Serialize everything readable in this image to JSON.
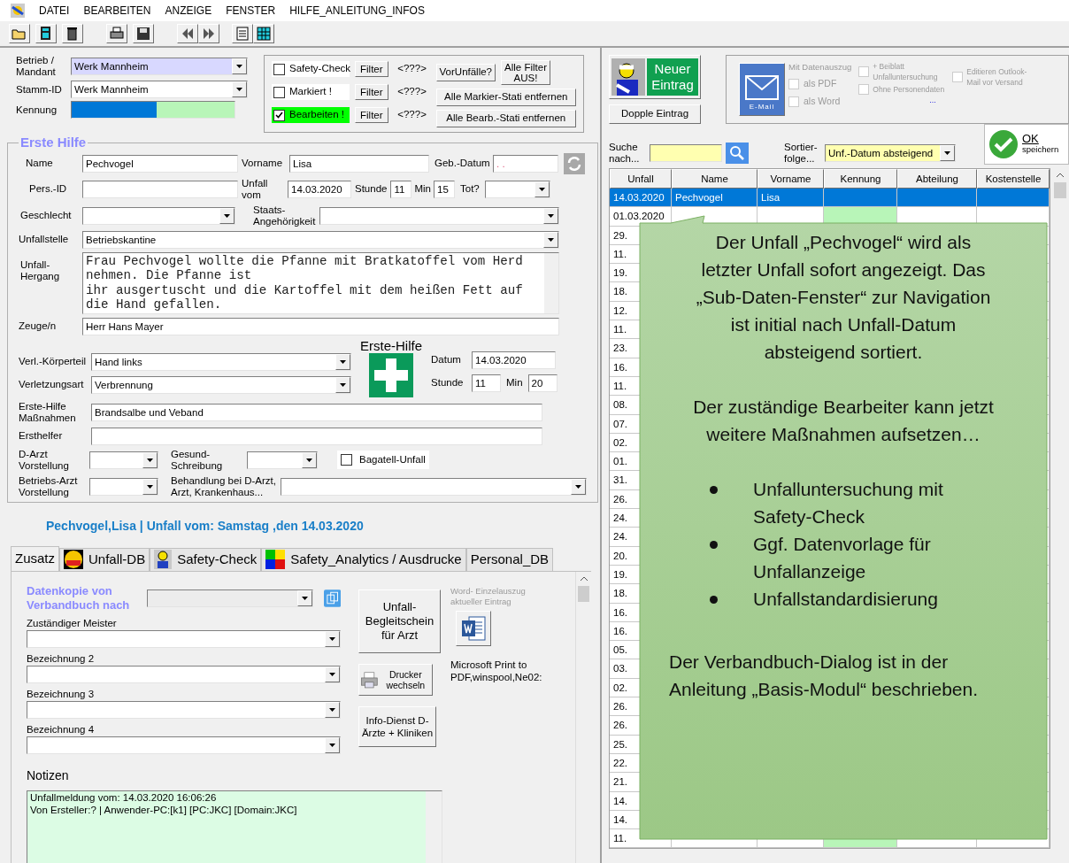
{
  "menu": [
    "DATEI",
    "BEARBEITEN",
    "ANZEIGE",
    "FENSTER",
    "HILFE_ANLEITUNG_INFOS"
  ],
  "header": {
    "betrieb_label": "Betrieb / Mandant",
    "betrieb": "Werk Mannheim",
    "stamm_label": "Stamm-ID",
    "stamm": "Werk Mannheim",
    "kennung": {
      "label": "Kennung",
      "level": 0.52
    }
  },
  "filters": [
    {
      "label": "Safety-Check",
      "checked": false,
      "highlighted": false,
      "button": "Filter",
      "value": "<???>"
    },
    {
      "label": "Markiert !",
      "checked": false,
      "highlighted": false,
      "button": "Filter",
      "value": "<???>"
    },
    {
      "label": "Bearbeiten !",
      "checked": true,
      "highlighted": true,
      "button": "Filter",
      "value": "<???>"
    }
  ],
  "filter_actions": [
    "VorUnfälle?",
    "Alle Filter AUS!",
    "Alle Markier-Stati entfernen",
    "Alle Bearb.-Stati entfernen"
  ],
  "erste_hilfe": {
    "title": "Erste Hilfe",
    "name": {
      "label": "Name",
      "value": "Pechvogel"
    },
    "vorname": {
      "label": "Vorname",
      "value": "Lisa"
    },
    "geb_datum": {
      "label": "Geb.-Datum",
      "value": ". ."
    },
    "pers_id": {
      "label": "Pers.-ID"
    },
    "unfall_vom": {
      "label": "Unfall vom",
      "value": "14.03.2020",
      "stunde_label": "Stunde",
      "stunde": "11",
      "min_label": "Min",
      "min": "15",
      "tot_label": "Tot?"
    },
    "geschlecht": {
      "label": "Geschlecht"
    },
    "staat": {
      "label": "Staats-Angehörigkeit"
    },
    "unfallstelle": {
      "label": "Unfallstelle",
      "value": "Betriebskantine"
    },
    "hergang": {
      "label": "Unfall-Hergang",
      "lines": [
        "Frau Pechvogel wollte die Pfanne mit Bratkatoffel vom Herd nehmen. Die Pfanne ist",
        "ihr ausgertuscht und die Kartoffel mit dem heißen Fett auf die Hand gefallen."
      ]
    },
    "zeuge": {
      "label": "Zeuge/n",
      "value": "Herr Hans Mayer"
    },
    "koerperteil": {
      "label": "Verl.-Körperteil",
      "value": "Hand links"
    },
    "verletzungsart": {
      "label": "Verletzungsart",
      "value": "Verbrennung"
    },
    "eh_block": {
      "title": "Erste-Hilfe",
      "datum_label": "Datum",
      "datum": "14.03.2020",
      "stunde_label": "Stunde",
      "stunde": "11",
      "min_label": "Min",
      "min": "20"
    },
    "massnahmen": {
      "label": "Erste-Hilfe Maßnahmen",
      "value": "Brandsalbe und Veband"
    },
    "ersthelfer": {
      "label": "Ersthelfer"
    },
    "d_arzt": {
      "label": "D-Arzt Vorstellung"
    },
    "gesund": {
      "label": "Gesund-Schreibung"
    },
    "bagatell": {
      "label": "Bagatell-Unfall",
      "checked": false
    },
    "betriebsarzt": {
      "label": "Betriebs-Arzt Vorstellung"
    },
    "behandlung": {
      "label": "Behandlung bei D-Arzt, Arzt, Krankenhaus..."
    }
  },
  "summary": "Pechvogel,Lisa | Unfall vom: Samstag ,den 14.03.2020",
  "tabs": [
    {
      "label": "Zusatz",
      "selected": true
    },
    {
      "label": "Unfall-DB",
      "selected": false
    },
    {
      "label": "Safety-Check",
      "selected": false
    },
    {
      "label": "Safety_Analytics / Ausdrucke",
      "selected": false
    },
    {
      "label": "Personal_DB",
      "selected": false
    }
  ],
  "zusatz": {
    "datenkopie_label": "Datenkopie von Verbandbuch nach",
    "combos": [
      "Zuständiger Meister",
      "Bezeichnung 2",
      "Bezeichnung 3",
      "Bezeichnung 4"
    ],
    "begleitschein": "Unfall-Begleitschein für Arzt",
    "word_label": "Word- Einzelauszug aktueller Eintrag",
    "drucker_button": "Drucker wechseln",
    "drucker": "Microsoft Print to PDF,winspool,Ne02:",
    "info_dienst": "Info-Dienst D-Ärzte + Kliniken",
    "notizen_label": "Notizen",
    "notizen": [
      "Unfallmeldung vom: 14.03.2020 16:06:26",
      "Von Ersteller:? | Anwender-PC:[k1] [PC:JKC] [Domain:JKC]"
    ]
  },
  "actions": {
    "neuer": "Neuer Eintrag",
    "dopple": "Dopple Eintrag",
    "ok": "OK",
    "ok_sub": "speichern"
  },
  "email": {
    "button": "E-Mail",
    "heading": "Mit Datenauszug",
    "options": [
      {
        "label": "als PDF",
        "checked": false
      },
      {
        "label": "als Word",
        "checked": false
      },
      {
        "label": "+ Beiblatt Unfalluntersuchung",
        "checked": false
      },
      {
        "label": "Ohne Personendaten",
        "checked": false
      },
      {
        "label": "Editieren Outlook-Mail vor Versand",
        "checked": false
      }
    ],
    "more": "..."
  },
  "search": {
    "label": "Suche nach...",
    "sort_label": "Sortier-folge...",
    "sort": "Unf.-Datum absteigend"
  },
  "table": {
    "columns": [
      "Unfall",
      "Name",
      "Vorname",
      "Kennung",
      "Abteilung",
      "Kostenstelle"
    ],
    "rows": [
      {
        "unfall": "14.03.2020",
        "name": "Pechvogel",
        "vorname": "Lisa",
        "selected": true,
        "kennung_marked": false
      },
      {
        "unfall": "01.03.2020",
        "selected": false,
        "kennung_marked": true
      },
      {
        "unfall": "29.",
        "selected": false
      },
      {
        "unfall": "11.",
        "selected": false
      },
      {
        "unfall": "19.",
        "selected": false
      },
      {
        "unfall": "18.",
        "selected": false
      },
      {
        "unfall": "12.",
        "selected": false
      },
      {
        "unfall": "11.",
        "selected": false
      },
      {
        "unfall": "23.",
        "selected": false
      },
      {
        "unfall": "16.",
        "selected": false
      },
      {
        "unfall": "11.",
        "selected": false
      },
      {
        "unfall": "08.",
        "selected": false
      },
      {
        "unfall": "07.",
        "selected": false
      },
      {
        "unfall": "02.",
        "selected": false
      },
      {
        "unfall": "01.",
        "selected": false
      },
      {
        "unfall": "31.",
        "selected": false
      },
      {
        "unfall": "26.",
        "selected": false
      },
      {
        "unfall": "24.",
        "selected": false
      },
      {
        "unfall": "24.",
        "selected": false
      },
      {
        "unfall": "20.",
        "selected": false
      },
      {
        "unfall": "19.",
        "selected": false
      },
      {
        "unfall": "18.",
        "selected": false
      },
      {
        "unfall": "16.",
        "selected": false
      },
      {
        "unfall": "16.",
        "selected": false
      },
      {
        "unfall": "05.",
        "selected": false
      },
      {
        "unfall": "03.",
        "selected": false
      },
      {
        "unfall": "02.",
        "selected": false
      },
      {
        "unfall": "26.",
        "selected": false
      },
      {
        "unfall": "26.",
        "selected": false
      },
      {
        "unfall": "25.",
        "selected": false
      },
      {
        "unfall": "22.",
        "selected": false
      },
      {
        "unfall": "21.",
        "selected": false
      },
      {
        "unfall": "14.",
        "selected": false
      },
      {
        "unfall": "14.",
        "selected": false
      },
      {
        "unfall": "11.",
        "selected": false,
        "kennung_marked": true
      }
    ]
  },
  "callout": {
    "paragraphs": [
      "Der Unfall „Pechvogel“ wird als letzter Unfall sofort angezeigt. Das „Sub-Daten-Fenster“ zur Navigation ist initial nach Unfall-Datum absteigend sortiert.",
      "Der zuständige Bearbeiter kann jetzt weitere Maßnahmen aufsetzen…"
    ],
    "bullets": [
      "Unfalluntersuchung mit Safety-Check",
      "Ggf. Datenvorlage für Unfallanzeige",
      "Unfallstandardisierung"
    ],
    "footer": "Der Verbandbuch-Dialog ist in der Anleitung „Basis-Modul“ beschrieben."
  }
}
